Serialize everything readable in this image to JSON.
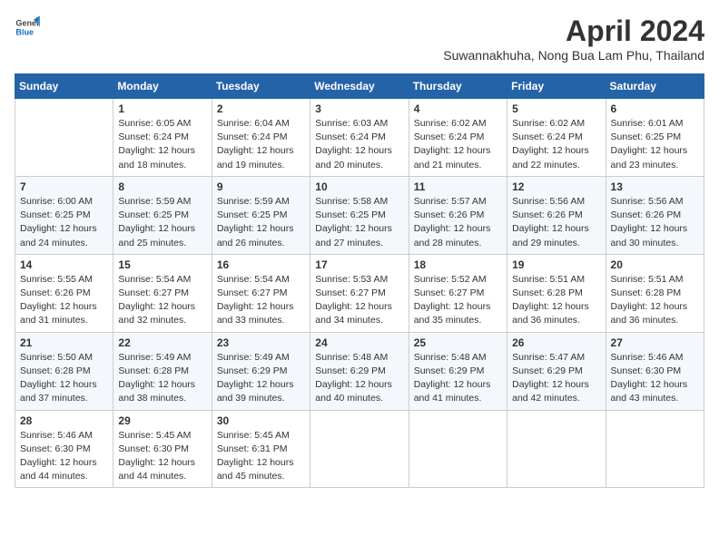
{
  "header": {
    "logo_general": "General",
    "logo_blue": "Blue",
    "month_title": "April 2024",
    "subtitle": "Suwannakhuha, Nong Bua Lam Phu, Thailand"
  },
  "columns": [
    "Sunday",
    "Monday",
    "Tuesday",
    "Wednesday",
    "Thursday",
    "Friday",
    "Saturday"
  ],
  "weeks": [
    [
      {
        "day": "",
        "info": ""
      },
      {
        "day": "1",
        "info": "Sunrise: 6:05 AM\nSunset: 6:24 PM\nDaylight: 12 hours\nand 18 minutes."
      },
      {
        "day": "2",
        "info": "Sunrise: 6:04 AM\nSunset: 6:24 PM\nDaylight: 12 hours\nand 19 minutes."
      },
      {
        "day": "3",
        "info": "Sunrise: 6:03 AM\nSunset: 6:24 PM\nDaylight: 12 hours\nand 20 minutes."
      },
      {
        "day": "4",
        "info": "Sunrise: 6:02 AM\nSunset: 6:24 PM\nDaylight: 12 hours\nand 21 minutes."
      },
      {
        "day": "5",
        "info": "Sunrise: 6:02 AM\nSunset: 6:24 PM\nDaylight: 12 hours\nand 22 minutes."
      },
      {
        "day": "6",
        "info": "Sunrise: 6:01 AM\nSunset: 6:25 PM\nDaylight: 12 hours\nand 23 minutes."
      }
    ],
    [
      {
        "day": "7",
        "info": "Sunrise: 6:00 AM\nSunset: 6:25 PM\nDaylight: 12 hours\nand 24 minutes."
      },
      {
        "day": "8",
        "info": "Sunrise: 5:59 AM\nSunset: 6:25 PM\nDaylight: 12 hours\nand 25 minutes."
      },
      {
        "day": "9",
        "info": "Sunrise: 5:59 AM\nSunset: 6:25 PM\nDaylight: 12 hours\nand 26 minutes."
      },
      {
        "day": "10",
        "info": "Sunrise: 5:58 AM\nSunset: 6:25 PM\nDaylight: 12 hours\nand 27 minutes."
      },
      {
        "day": "11",
        "info": "Sunrise: 5:57 AM\nSunset: 6:26 PM\nDaylight: 12 hours\nand 28 minutes."
      },
      {
        "day": "12",
        "info": "Sunrise: 5:56 AM\nSunset: 6:26 PM\nDaylight: 12 hours\nand 29 minutes."
      },
      {
        "day": "13",
        "info": "Sunrise: 5:56 AM\nSunset: 6:26 PM\nDaylight: 12 hours\nand 30 minutes."
      }
    ],
    [
      {
        "day": "14",
        "info": "Sunrise: 5:55 AM\nSunset: 6:26 PM\nDaylight: 12 hours\nand 31 minutes."
      },
      {
        "day": "15",
        "info": "Sunrise: 5:54 AM\nSunset: 6:27 PM\nDaylight: 12 hours\nand 32 minutes."
      },
      {
        "day": "16",
        "info": "Sunrise: 5:54 AM\nSunset: 6:27 PM\nDaylight: 12 hours\nand 33 minutes."
      },
      {
        "day": "17",
        "info": "Sunrise: 5:53 AM\nSunset: 6:27 PM\nDaylight: 12 hours\nand 34 minutes."
      },
      {
        "day": "18",
        "info": "Sunrise: 5:52 AM\nSunset: 6:27 PM\nDaylight: 12 hours\nand 35 minutes."
      },
      {
        "day": "19",
        "info": "Sunrise: 5:51 AM\nSunset: 6:28 PM\nDaylight: 12 hours\nand 36 minutes."
      },
      {
        "day": "20",
        "info": "Sunrise: 5:51 AM\nSunset: 6:28 PM\nDaylight: 12 hours\nand 36 minutes."
      }
    ],
    [
      {
        "day": "21",
        "info": "Sunrise: 5:50 AM\nSunset: 6:28 PM\nDaylight: 12 hours\nand 37 minutes."
      },
      {
        "day": "22",
        "info": "Sunrise: 5:49 AM\nSunset: 6:28 PM\nDaylight: 12 hours\nand 38 minutes."
      },
      {
        "day": "23",
        "info": "Sunrise: 5:49 AM\nSunset: 6:29 PM\nDaylight: 12 hours\nand 39 minutes."
      },
      {
        "day": "24",
        "info": "Sunrise: 5:48 AM\nSunset: 6:29 PM\nDaylight: 12 hours\nand 40 minutes."
      },
      {
        "day": "25",
        "info": "Sunrise: 5:48 AM\nSunset: 6:29 PM\nDaylight: 12 hours\nand 41 minutes."
      },
      {
        "day": "26",
        "info": "Sunrise: 5:47 AM\nSunset: 6:29 PM\nDaylight: 12 hours\nand 42 minutes."
      },
      {
        "day": "27",
        "info": "Sunrise: 5:46 AM\nSunset: 6:30 PM\nDaylight: 12 hours\nand 43 minutes."
      }
    ],
    [
      {
        "day": "28",
        "info": "Sunrise: 5:46 AM\nSunset: 6:30 PM\nDaylight: 12 hours\nand 44 minutes."
      },
      {
        "day": "29",
        "info": "Sunrise: 5:45 AM\nSunset: 6:30 PM\nDaylight: 12 hours\nand 44 minutes."
      },
      {
        "day": "30",
        "info": "Sunrise: 5:45 AM\nSunset: 6:31 PM\nDaylight: 12 hours\nand 45 minutes."
      },
      {
        "day": "",
        "info": ""
      },
      {
        "day": "",
        "info": ""
      },
      {
        "day": "",
        "info": ""
      },
      {
        "day": "",
        "info": ""
      }
    ]
  ]
}
